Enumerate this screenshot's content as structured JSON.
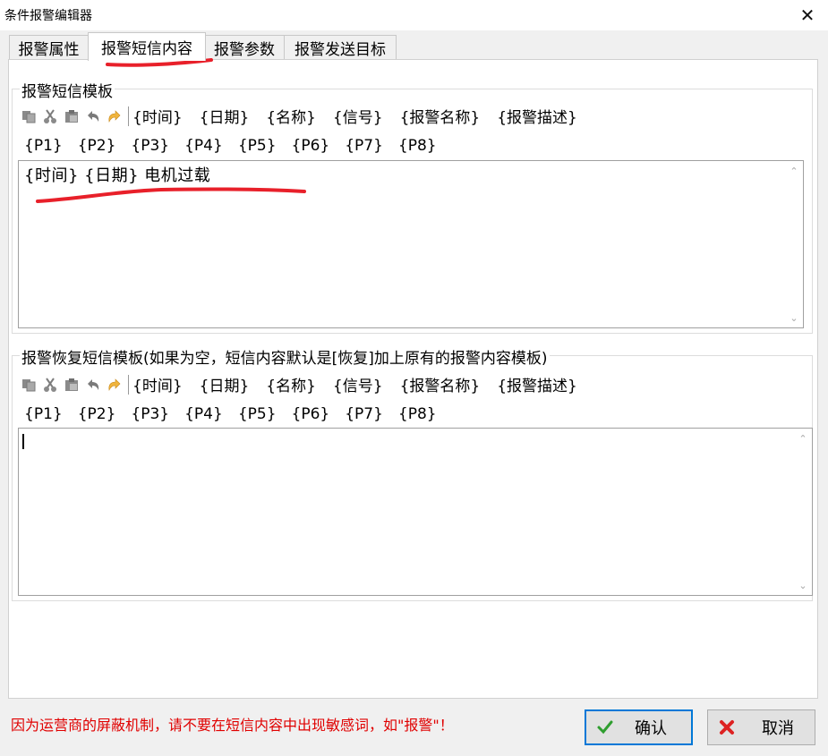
{
  "window": {
    "title": "条件报警编辑器"
  },
  "tabs": [
    "报警属性",
    "报警短信内容",
    "报警参数",
    "报警发送目标"
  ],
  "active_tab": 1,
  "sms_template": {
    "label": "报警短信模板",
    "tokens_row1": [
      "{时间}",
      "{日期}",
      "{名称}",
      "{信号}",
      "{报警名称}",
      "{报警描述}"
    ],
    "tokens_row2": [
      "{P1}",
      "{P2}",
      "{P3}",
      "{P4}",
      "{P5}",
      "{P6}",
      "{P7}",
      "{P8}"
    ],
    "content": "{时间} {日期} 电机过载"
  },
  "recovery_template": {
    "label": "报警恢复短信模板(如果为空，短信内容默认是[恢复]加上原有的报警内容模板)",
    "tokens_row1": [
      "{时间}",
      "{日期}",
      "{名称}",
      "{信号}",
      "{报警名称}",
      "{报警描述}"
    ],
    "tokens_row2": [
      "{P1}",
      "{P2}",
      "{P3}",
      "{P4}",
      "{P5}",
      "{P6}",
      "{P7}",
      "{P8}"
    ],
    "content": ""
  },
  "toolbar_icons": [
    "copy-icon",
    "cut-icon",
    "paste-icon",
    "undo-icon",
    "redo-icon"
  ],
  "warning": "因为运营商的屏蔽机制，请不要在短信内容中出现敏感词，如\"报警\"！",
  "buttons": {
    "ok": "确认",
    "cancel": "取消"
  },
  "colors": {
    "annotation": "#e8202a",
    "warning": "#e00000",
    "focus": "#0078d7"
  }
}
